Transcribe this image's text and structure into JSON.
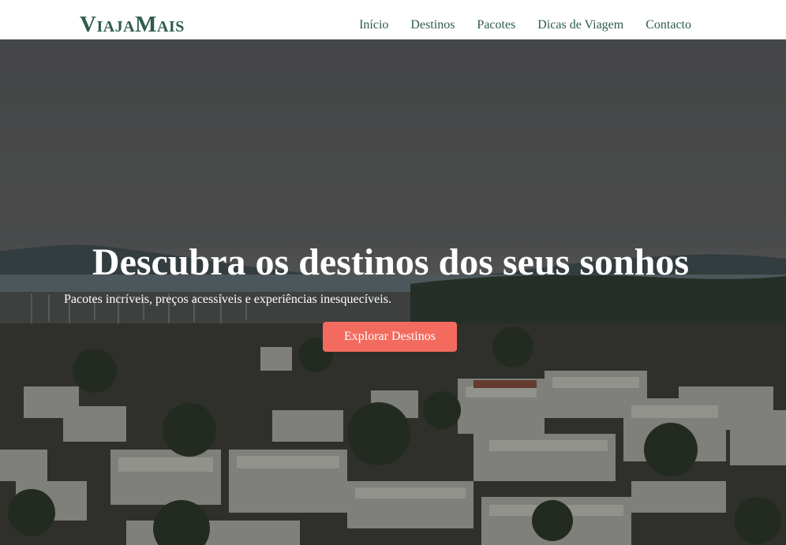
{
  "header": {
    "logo": "ViajaMais",
    "nav": [
      {
        "label": "Início"
      },
      {
        "label": "Destinos"
      },
      {
        "label": "Pacotes"
      },
      {
        "label": "Dicas de Viagem"
      },
      {
        "label": "Contacto"
      }
    ]
  },
  "hero": {
    "title": "Descubra os destinos dos seus sonhos",
    "subtitle": "Pacotes incríveis, preços acessíveis e experiências inesquecíveis.",
    "cta_label": "Explorar Destinos"
  },
  "colors": {
    "brand": "#2e5d4b",
    "cta": "#f36b5f",
    "header_bg": "#ffffff"
  }
}
